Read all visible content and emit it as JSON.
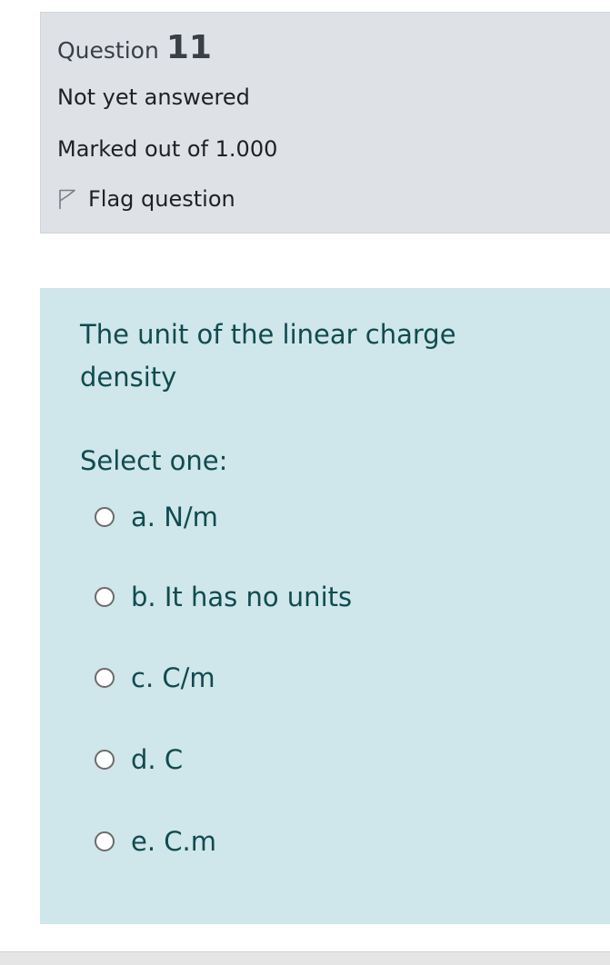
{
  "question_info": {
    "label": "Question",
    "number": "11",
    "state": "Not yet answered",
    "grade": "Marked out of 1.000",
    "flag_label": "Flag question"
  },
  "question": {
    "text": "The unit of the linear charge density",
    "prompt": "Select one:",
    "options": [
      {
        "label": "a. N/m"
      },
      {
        "label": "b. It has no units"
      },
      {
        "label": "c. C/m"
      },
      {
        "label": "d. C"
      },
      {
        "label": "e. C.m"
      }
    ]
  },
  "colors": {
    "info_bg": "#dee2e6",
    "content_bg": "#cfe6ea",
    "content_text": "#0f4b4f"
  }
}
